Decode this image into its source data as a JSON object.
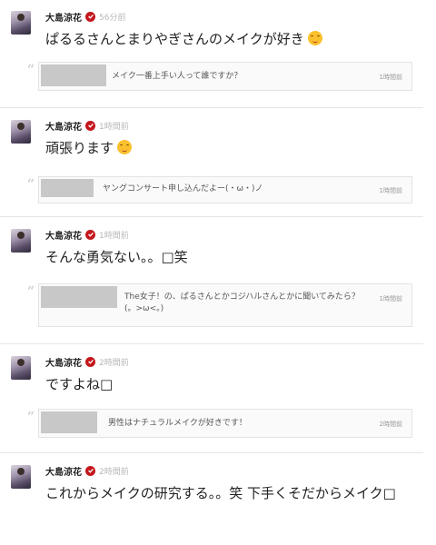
{
  "posts": [
    {
      "author": "大島涼花",
      "time": "56分前",
      "message": "ぱるるさんとまりやぎさんのメイクが好き",
      "emoji": "smiling-face",
      "reply": {
        "text": "メイク一番上手い人って誰ですか？",
        "time": "1時間前"
      }
    },
    {
      "author": "大島涼花",
      "time": "1時間前",
      "message": "頑張ります",
      "emoji": "blushing-face",
      "reply": {
        "text": "ヤングコンサート申し込んだよー(・ω・)ノ",
        "time": "1時間前"
      }
    },
    {
      "author": "大島涼花",
      "time": "1時間前",
      "message": "そんな勇気ない。。□笑",
      "reply": {
        "text": "The女子！の、ぱるさんとかコジハルさんとかに聞いてみたら？(。>ω<。)",
        "time": "1時間前"
      }
    },
    {
      "author": "大島涼花",
      "time": "2時間前",
      "message": "ですよね□",
      "reply": {
        "text": "男性はナチュラルメイクが好きです！",
        "time": "2時間前"
      }
    },
    {
      "author": "大島涼花",
      "time": "2時間前",
      "message": "これからメイクの研究する。。笑 下手くそだからメイク□"
    }
  ]
}
